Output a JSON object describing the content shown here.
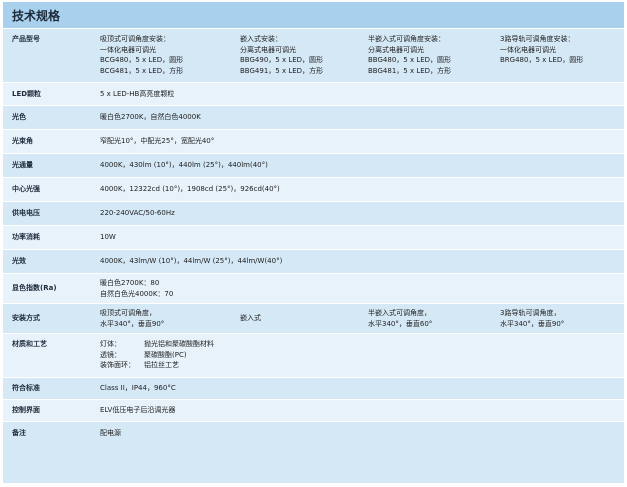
{
  "title": "技术规格",
  "rows": {
    "model": {
      "label": "产品型号",
      "cols": [
        [
          "吸顶式可调角度安装：",
          "一体化电器可调光",
          "BCG480，5 x LED，圆形",
          "BCG481，5 x LED，方形"
        ],
        [
          "嵌入式安装：",
          "分离式电器可调光",
          "BBG490，5 x LED，圆形",
          "BBG491，5 x LED，方形"
        ],
        [
          "半嵌入式可调角度安装：",
          "分离式电器可调光",
          "BBG480，5 x LED，圆形",
          "BBG481，5 x LED，方形"
        ],
        [
          "3路导轨可调角度安装：",
          "一体化电器可调光",
          "BRG480，5 x LED，圆形"
        ]
      ]
    },
    "led": {
      "label": "LED颗粒",
      "value": "5 x LED-HB高亮度颗粒"
    },
    "color": {
      "label": "光色",
      "value": "暖白色2700K，自然白色4000K"
    },
    "beam": {
      "label": "光束角",
      "value": "窄配光10°，中配光25°，宽配光40°"
    },
    "flux": {
      "label": "光通量",
      "value": "4000K，430lm (10°)，440lm (25°)，440lm(40°)"
    },
    "intensity": {
      "label": "中心光强",
      "value": "4000K，12322cd (10°)，1908cd (25°)，926cd(40°)"
    },
    "voltage": {
      "label": "供电电压",
      "value": "220-240VAC/50-60Hz"
    },
    "power": {
      "label": "功率消耗",
      "value": "10W"
    },
    "efficacy": {
      "label": "光效",
      "value": "4000K，43lm/W (10°)，44lm/W (25°)，44lm/W(40°)"
    },
    "cri": {
      "label": "显色指数(Ra)",
      "lines": [
        "暖白色2700K：80",
        "自然白色光4000K：70"
      ]
    },
    "install": {
      "label": "安装方式",
      "cols": [
        [
          "吸顶式可调角度，",
          "水平340°，垂直90°"
        ],
        [
          "嵌入式"
        ],
        [
          "半嵌入式可调角度，",
          "水平340°，垂直60°"
        ],
        [
          "3路导轨可调角度，",
          "水平340°，垂直90°"
        ]
      ]
    },
    "material": {
      "label": "材质和工艺",
      "items": [
        {
          "k": "灯体：",
          "v": "抛光铝和聚碳酸酯材料"
        },
        {
          "k": "透镜：",
          "v": "聚碳酸酯(PC)"
        },
        {
          "k": "装饰面环：",
          "v": "铝拉丝工艺"
        }
      ]
    },
    "standard": {
      "label": "符合标准",
      "value": "Class II，IP44，960°C"
    },
    "control": {
      "label": "控制界面",
      "value": "ELV低压电子后沿调光器"
    },
    "note": {
      "label": "备注",
      "value": "配电源"
    }
  }
}
